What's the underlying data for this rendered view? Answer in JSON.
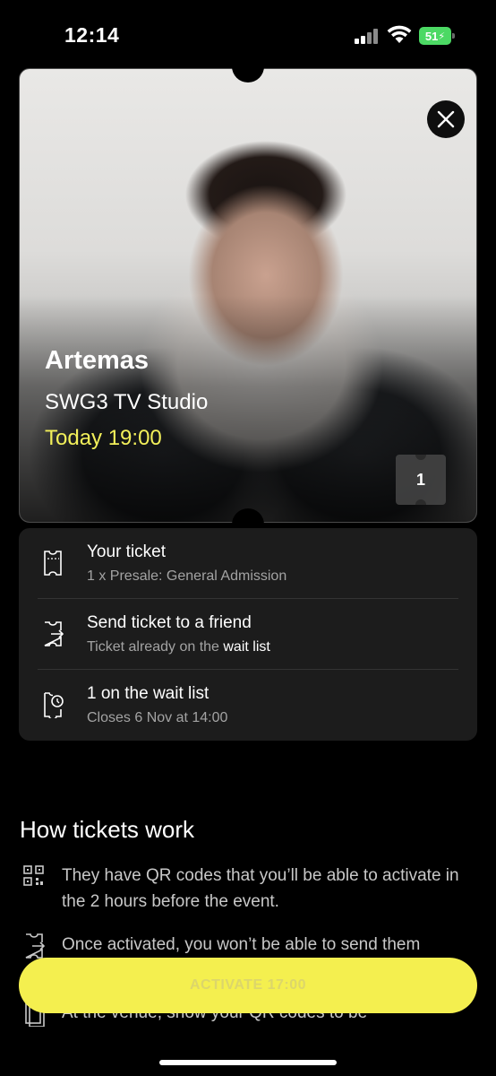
{
  "status_bar": {
    "time": "12:14",
    "battery": "51",
    "icons": [
      "signal-icon",
      "wifi-icon",
      "battery-icon"
    ]
  },
  "event": {
    "title": "Artemas",
    "venue": "SWG3 TV Studio",
    "time": "Today 19:00",
    "ticket_count": "1"
  },
  "details": [
    {
      "icon": "ticket-icon",
      "title": "Your ticket",
      "sub": "1 x Presale: General Admission"
    },
    {
      "icon": "send-ticket-icon",
      "title": "Send ticket to a friend",
      "sub_prefix": "Ticket already on the ",
      "sub_link": "wait list"
    },
    {
      "icon": "waitlist-clock-icon",
      "title": "1 on the wait list",
      "sub": "Closes 6 Nov at 14:00"
    }
  ],
  "how": {
    "title": "How tickets work",
    "items": [
      {
        "icon": "qr-code-icon",
        "text": "They have QR codes that you’ll be able to activate in the 2 hours before the event."
      },
      {
        "icon": "send-ticket-icon",
        "text": "Once activated, you won’t be able to send them"
      },
      {
        "icon": "venue-ticket-icon",
        "text": "At the venue, show your QR codes to be"
      }
    ]
  },
  "activate_button": "ACTIVATE 17:00",
  "colors": {
    "accent_yellow": "#f4ef4f",
    "event_time": "#f2ef5a",
    "panel_bg": "#1c1c1c"
  }
}
